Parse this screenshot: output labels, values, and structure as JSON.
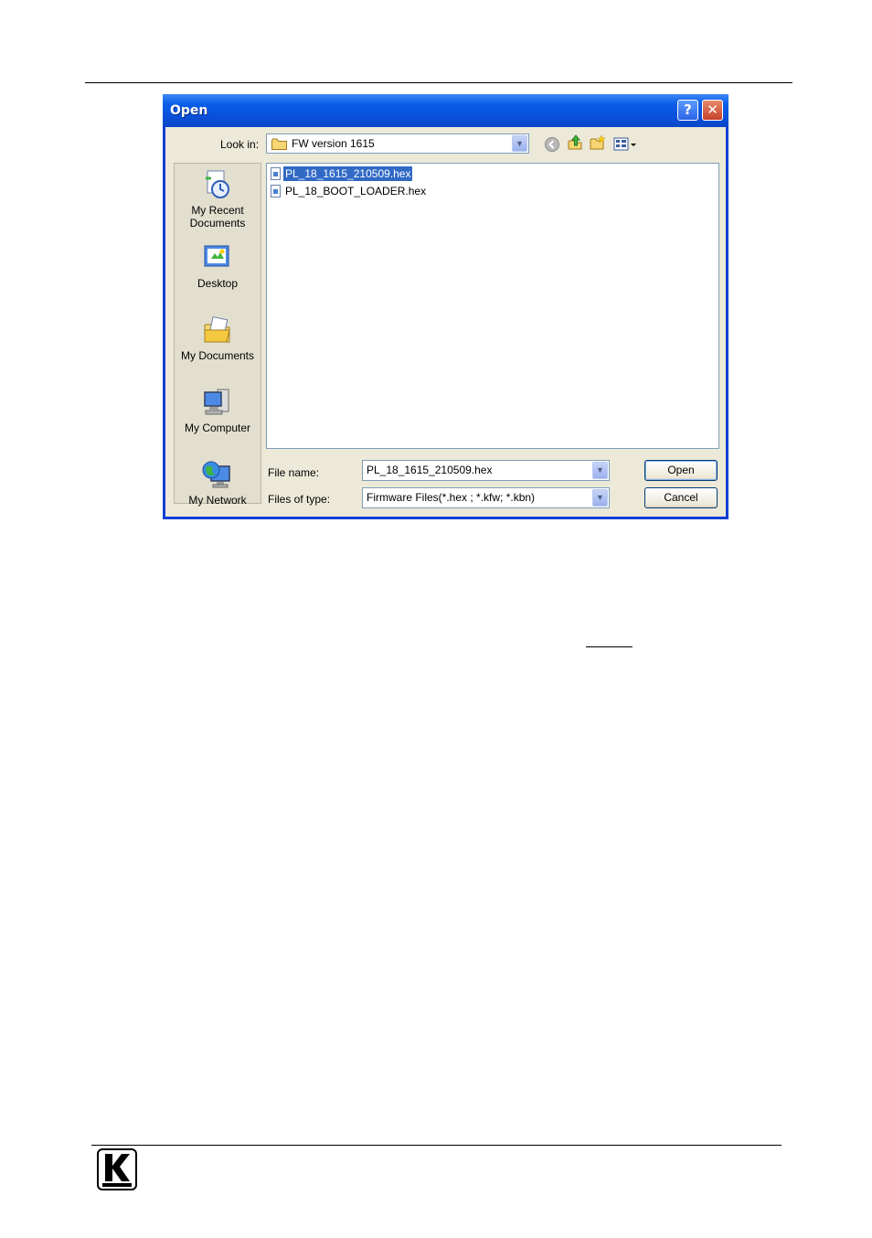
{
  "dialog": {
    "title": "Open",
    "help_label": "?",
    "close_label": "✕"
  },
  "lookin": {
    "label": "Look in:",
    "value": "FW version 1615"
  },
  "places": [
    {
      "label_line1": "My Recent",
      "label_line2": "Documents",
      "icon": "recent-documents-icon"
    },
    {
      "label_line1": "Desktop",
      "label_line2": "",
      "icon": "desktop-icon"
    },
    {
      "label_line1": "My Documents",
      "label_line2": "",
      "icon": "my-documents-icon"
    },
    {
      "label_line1": "My Computer",
      "label_line2": "",
      "icon": "my-computer-icon"
    },
    {
      "label_line1": "My Network",
      "label_line2": "",
      "icon": "my-network-icon"
    }
  ],
  "files": [
    {
      "name": "PL_18_1615_210509.hex",
      "selected": true
    },
    {
      "name": "PL_18_BOOT_LOADER.hex",
      "selected": false
    }
  ],
  "filename": {
    "label": "File name:",
    "value": "PL_18_1615_210509.hex"
  },
  "filetype": {
    "label": "Files of type:",
    "value": "Firmware Files(*.hex ; *.kfw; *.kbn)"
  },
  "buttons": {
    "open_label": "Open",
    "cancel_label": "Cancel"
  },
  "colors": {
    "titlebar": "#0a4fd8",
    "selection": "#316ac5",
    "client": "#ece9d8"
  }
}
